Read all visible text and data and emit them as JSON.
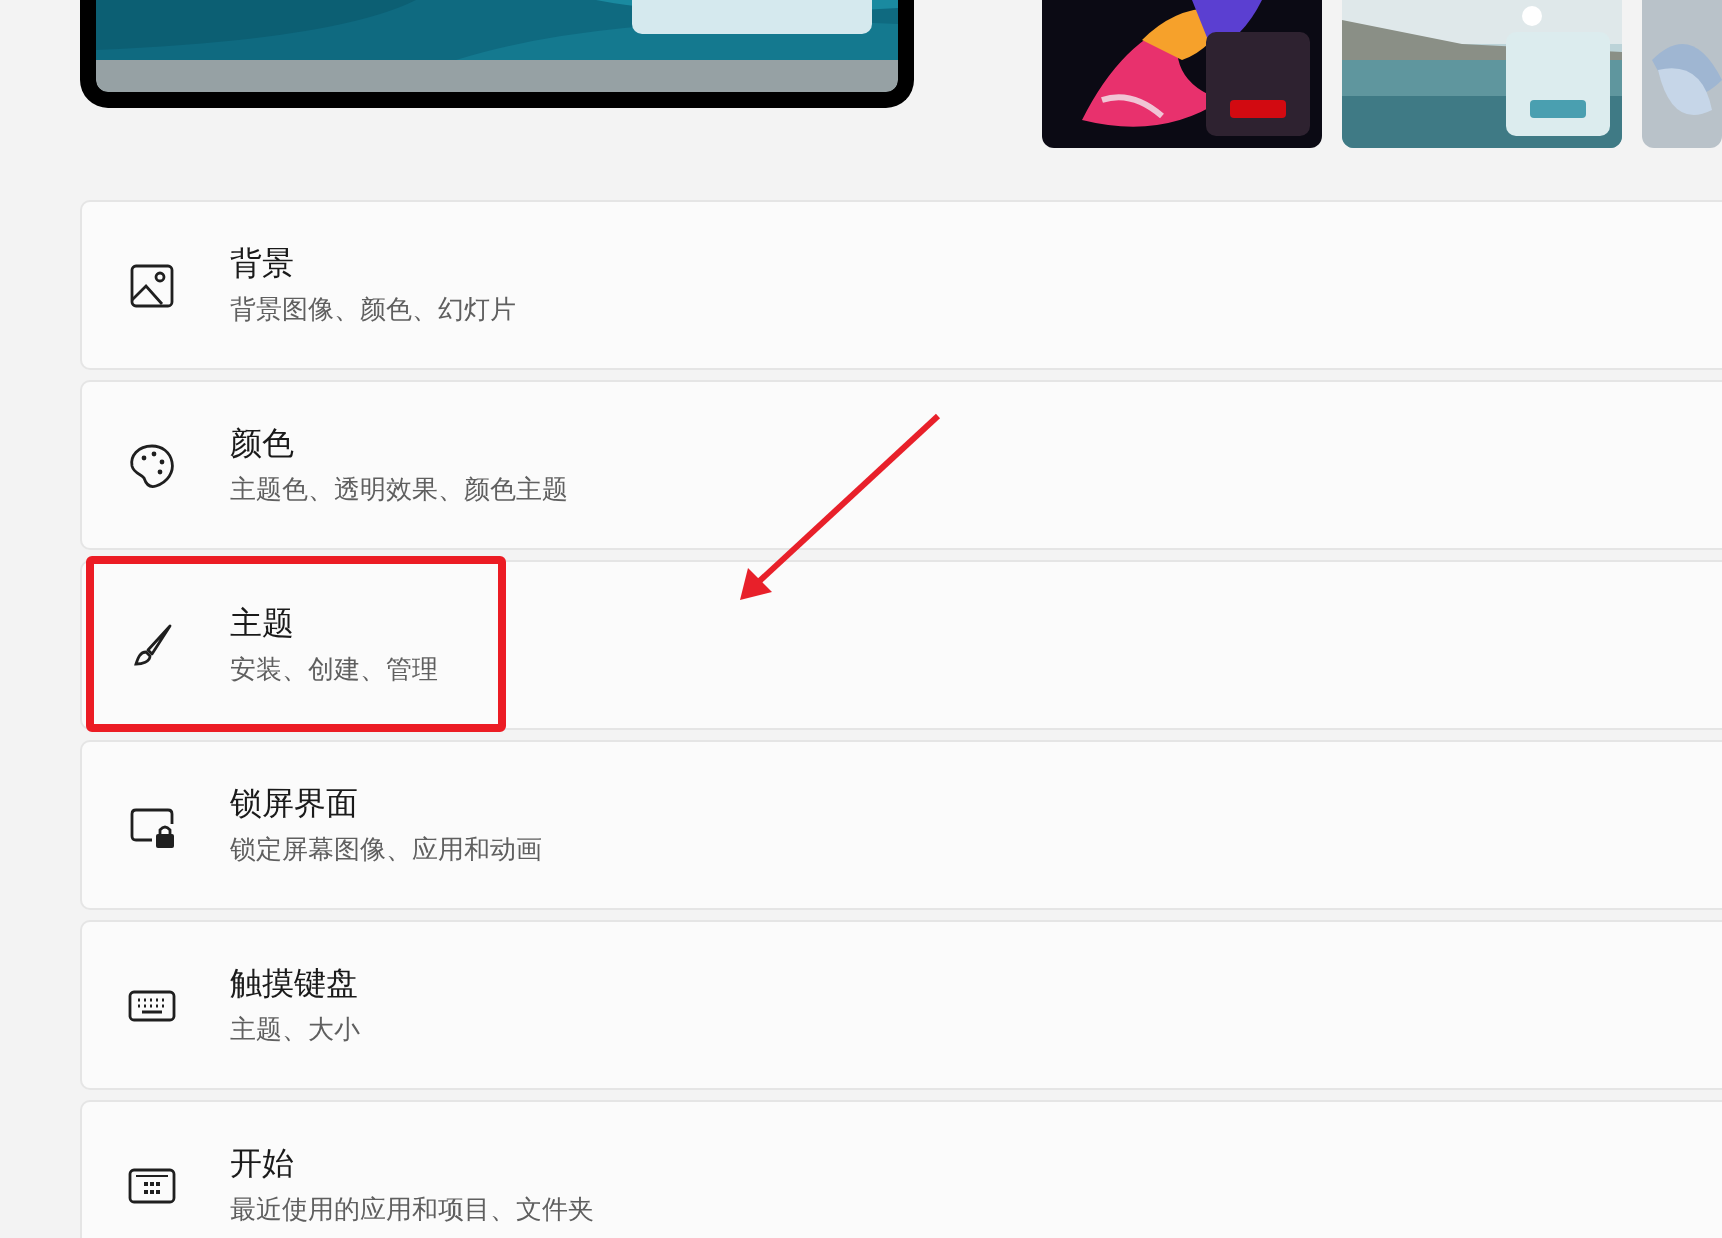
{
  "items": [
    {
      "title": "背景",
      "subtitle": "背景图像、颜色、幻灯片",
      "highlighted": false
    },
    {
      "title": "颜色",
      "subtitle": "主题色、透明效果、颜色主题",
      "highlighted": false
    },
    {
      "title": "主题",
      "subtitle": "安装、创建、管理",
      "highlighted": true
    },
    {
      "title": "锁屏界面",
      "subtitle": "锁定屏幕图像、应用和动画",
      "highlighted": false
    },
    {
      "title": "触摸键盘",
      "subtitle": "主题、大小",
      "highlighted": false
    },
    {
      "title": "开始",
      "subtitle": "最近使用的应用和项目、文件夹",
      "highlighted": false
    }
  ]
}
